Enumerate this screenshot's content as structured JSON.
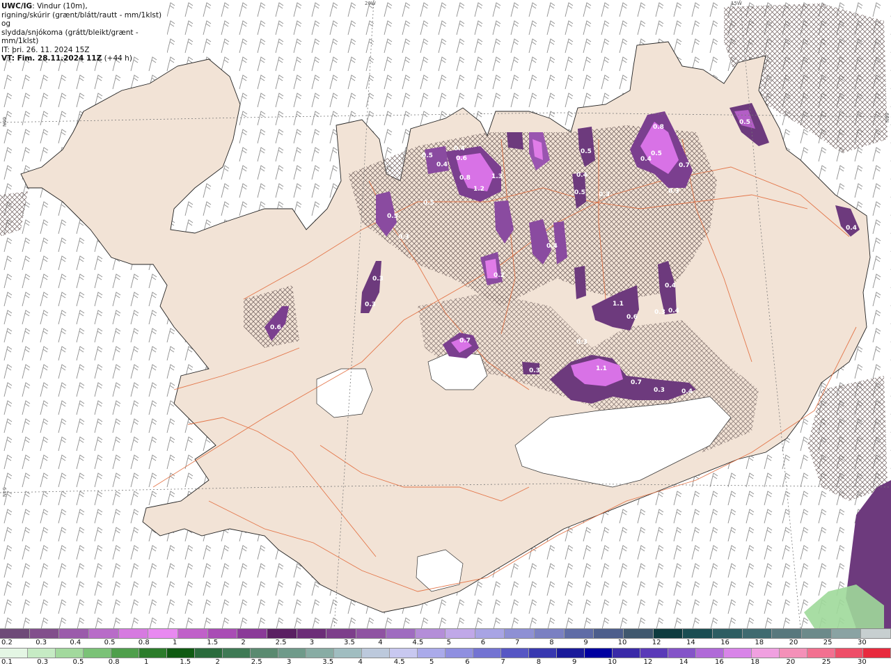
{
  "header": {
    "source": "UWC/IG",
    "line1_rest": ": Vindur (10m),",
    "line2": "rigning/skúrir (grænt/blátt/rautt - mm/1klst) og",
    "line3": "slydda/snjókoma (grátt/bleikt/grænt - mm/1klst)",
    "line4": "IT: þri. 26. 11. 2024 15Z",
    "line5_bold": "VT: Fim. 28.11.2024 11Z",
    "line5_rest": " (+44 h)"
  },
  "grid_labels": {
    "lon_20w": "20W",
    "lon_15w": "15W",
    "lat_66n_left": "66N",
    "lat_66n_right": "66N",
    "lat_64n_left": "64N"
  },
  "precip_labels": [
    {
      "text": "0.5"
    },
    {
      "text": "0.4"
    },
    {
      "text": "0.8"
    },
    {
      "text": "0.5"
    },
    {
      "text": "0.7"
    },
    {
      "text": "0.3"
    },
    {
      "text": "0.5"
    },
    {
      "text": "0.4"
    },
    {
      "text": "0.5"
    },
    {
      "text": "0.4"
    },
    {
      "text": "0.4"
    },
    {
      "text": "0.6"
    },
    {
      "text": "0.8"
    },
    {
      "text": "1.2"
    },
    {
      "text": "1.3"
    },
    {
      "text": "0.5"
    },
    {
      "text": "0.5"
    },
    {
      "text": "0.3"
    },
    {
      "text": "0.5"
    },
    {
      "text": "0.4"
    },
    {
      "text": "0.3"
    },
    {
      "text": "0.3"
    },
    {
      "text": "0.3"
    },
    {
      "text": "0.4"
    },
    {
      "text": "1.1"
    },
    {
      "text": "0.6"
    },
    {
      "text": "0.3"
    },
    {
      "text": "0.4"
    },
    {
      "text": "0.4"
    },
    {
      "text": "0.6"
    },
    {
      "text": "0.7"
    },
    {
      "text": "0.3"
    },
    {
      "text": "1.1"
    },
    {
      "text": "0.7"
    },
    {
      "text": "0.3"
    },
    {
      "text": "0.4"
    },
    {
      "text": "0.3"
    },
    {
      "text": "0.2"
    },
    {
      "text": "0.3"
    }
  ],
  "legend_snow": {
    "colors": [
      "#6e4a78",
      "#824f8c",
      "#9b5bab",
      "#b86cc8",
      "#d67ae0",
      "#e889f0",
      "#c061c9",
      "#a94db5",
      "#8a3a98",
      "#5a1f62",
      "#6c2d78",
      "#7d3f8b",
      "#8f53a2",
      "#9f6cc0",
      "#b48ed8",
      "#c0a8e8",
      "#a8a4e4",
      "#8e90d4",
      "#7a80c2",
      "#5f6ca6",
      "#4d5e8c",
      "#40586e",
      "#0e3b3f",
      "#1a4d52",
      "#2d5d62",
      "#3f6a70",
      "#58787d",
      "#6c8a8a",
      "#8aa3a3",
      "#c7cfd0"
    ],
    "ticks": [
      "0.2",
      "0.3",
      "0.4",
      "0.5",
      "0.8",
      "1",
      "1.5",
      "2",
      "2.5",
      "3",
      "3.5",
      "4",
      "4.5",
      "5",
      "6",
      "7",
      "8",
      "9",
      "10",
      "12",
      "14",
      "16",
      "18",
      "20",
      "25",
      "30"
    ]
  },
  "legend_rain": {
    "colors": [
      "#e4f6e4",
      "#c6ebc4",
      "#a2d99d",
      "#7bc277",
      "#4f9f4c",
      "#2c7c2b",
      "#0f5a12",
      "#2a6b3c",
      "#3f7a55",
      "#5a8a70",
      "#6f9a8a",
      "#88aca4",
      "#a0bdc0",
      "#bcc9dc",
      "#c8c8f0",
      "#aaaaea",
      "#8f8fe0",
      "#7373d2",
      "#5656c4",
      "#3838b0",
      "#1a1a9a",
      "#0000a0",
      "#3a2aa8",
      "#5a3ab8",
      "#8454c8",
      "#b06ad8",
      "#d884e8",
      "#f0a0e0",
      "#f490b8",
      "#f27090",
      "#ee4e68",
      "#e82a3e"
    ],
    "ticks": [
      "0.1",
      "0.3",
      "0.5",
      "0.8",
      "1",
      "1.5",
      "2",
      "2.5",
      "3",
      "3.5",
      "4",
      "4.5",
      "5",
      "6",
      "7",
      "8",
      "9",
      "10",
      "12",
      "14",
      "16",
      "18",
      "20",
      "25",
      "30"
    ]
  }
}
